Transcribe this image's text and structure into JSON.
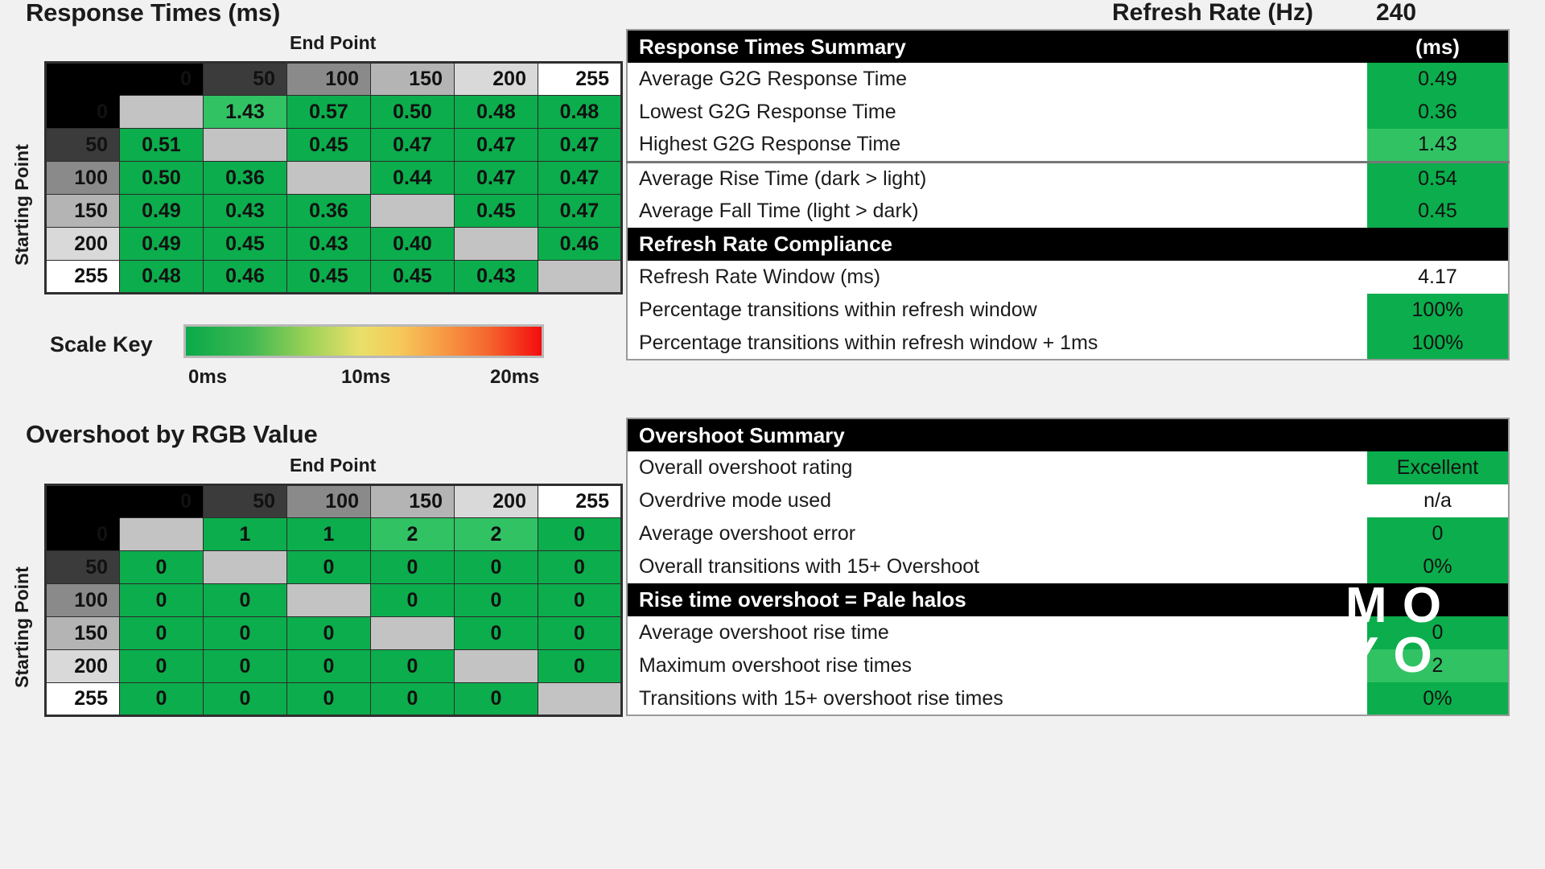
{
  "page": {
    "background": "#f1f1f1",
    "accent_green": "#0cad4c",
    "accent_green_light": "#31c264",
    "na_gray": "#c3c3c3"
  },
  "refresh_rate": {
    "label": "Refresh Rate (Hz)",
    "value": "240"
  },
  "watermark": {
    "line1": "M O",
    "line2": "Y O",
    "l1a": "M",
    "l1b": "O",
    "l2a": "Y",
    "l2b": "O"
  },
  "response_matrix": {
    "title": "Response Times (ms)",
    "x_axis_label": "End Point",
    "y_axis_label": "Starting Point",
    "headers": [
      "0",
      "50",
      "100",
      "150",
      "200",
      "255"
    ],
    "rows": [
      {
        "header": "0",
        "cells": [
          "",
          "1.43",
          "0.57",
          "0.50",
          "0.48",
          "0.48"
        ]
      },
      {
        "header": "50",
        "cells": [
          "0.51",
          "",
          "0.45",
          "0.47",
          "0.47",
          "0.47"
        ]
      },
      {
        "header": "100",
        "cells": [
          "0.50",
          "0.36",
          "",
          "0.44",
          "0.47",
          "0.47"
        ]
      },
      {
        "header": "150",
        "cells": [
          "0.49",
          "0.43",
          "0.36",
          "",
          "0.45",
          "0.47"
        ]
      },
      {
        "header": "200",
        "cells": [
          "0.49",
          "0.45",
          "0.43",
          "0.40",
          "",
          "0.46"
        ]
      },
      {
        "header": "255",
        "cells": [
          "0.48",
          "0.46",
          "0.45",
          "0.45",
          "0.43",
          ""
        ]
      }
    ]
  },
  "scale_key": {
    "label": "Scale Key",
    "ticks": [
      "0ms",
      "10ms",
      "20ms"
    ]
  },
  "overshoot_matrix": {
    "title": "Overshoot by RGB Value",
    "x_axis_label": "End Point",
    "y_axis_label": "Starting Point",
    "headers": [
      "0",
      "50",
      "100",
      "150",
      "200",
      "255"
    ],
    "rows": [
      {
        "header": "0",
        "cells": [
          "",
          "1",
          "1",
          "2",
          "2",
          "0"
        ]
      },
      {
        "header": "50",
        "cells": [
          "0",
          "",
          "0",
          "0",
          "0",
          "0"
        ]
      },
      {
        "header": "100",
        "cells": [
          "0",
          "0",
          "",
          "0",
          "0",
          "0"
        ]
      },
      {
        "header": "150",
        "cells": [
          "0",
          "0",
          "0",
          "",
          "0",
          "0"
        ]
      },
      {
        "header": "200",
        "cells": [
          "0",
          "0",
          "0",
          "0",
          "",
          "0"
        ]
      },
      {
        "header": "255",
        "cells": [
          "0",
          "0",
          "0",
          "0",
          "0",
          ""
        ]
      }
    ]
  },
  "response_summary": {
    "title": "Response Times Summary",
    "unit": "(ms)",
    "rows": [
      {
        "label": "Average G2G Response Time",
        "value": "0.49",
        "style": "green"
      },
      {
        "label": "Lowest G2G Response Time",
        "value": "0.36",
        "style": "green"
      },
      {
        "label": "Highest G2G Response Time",
        "value": "1.43",
        "style": "lite"
      }
    ],
    "section2_title": "",
    "rows2": [
      {
        "label": "Average Rise Time (dark > light)",
        "value": "0.54",
        "style": "green"
      },
      {
        "label": "Average Fall Time (light > dark)",
        "value": "0.45",
        "style": "green"
      }
    ],
    "compliance_title": "Refresh Rate Compliance",
    "rows3": [
      {
        "label": "Refresh Rate Window (ms)",
        "value": "4.17",
        "style": "white"
      },
      {
        "label": "Percentage transitions within refresh window",
        "value": "100%",
        "style": "green"
      },
      {
        "label": "Percentage transitions within refresh window + 1ms",
        "value": "100%",
        "style": "green"
      }
    ]
  },
  "overshoot_summary": {
    "title": "Overshoot Summary",
    "rows": [
      {
        "label": "Overall overshoot rating",
        "value": "Excellent",
        "style": "green"
      },
      {
        "label": "Overdrive mode used",
        "value": "n/a",
        "style": "white"
      },
      {
        "label": "Average overshoot error",
        "value": "0",
        "style": "green"
      },
      {
        "label": "Overall transitions with 15+ Overshoot",
        "value": "0%",
        "style": "green"
      }
    ],
    "rise_title": "Rise time overshoot = Pale halos",
    "rows2": [
      {
        "label": "Average overshoot rise time",
        "value": "0",
        "style": "green"
      },
      {
        "label": "Maximum overshoot rise times",
        "value": "2",
        "style": "lite"
      },
      {
        "label": "Transitions with 15+ overshoot rise times",
        "value": "0%",
        "style": "green"
      }
    ]
  }
}
